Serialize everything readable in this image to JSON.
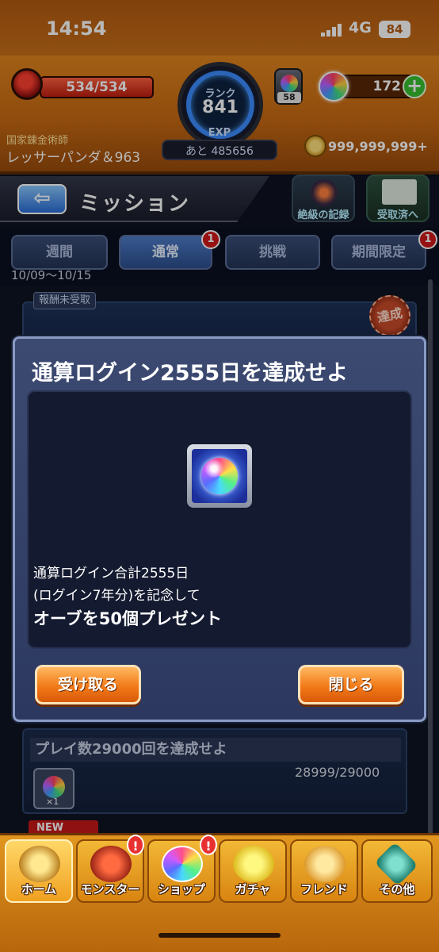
{
  "status_bar": {
    "time": "14:54",
    "network": "4G",
    "battery": "84"
  },
  "hud": {
    "stamina": "534/534",
    "stamina_fraction": 1.0,
    "rank_label": "ランク",
    "rank": "841",
    "exp_label": "EXP",
    "exp_remaining": "あと 485656",
    "orb_stock": "58",
    "orbs": "172",
    "user_title": "国家錬金術師",
    "user_name": "レッサーパンダ＆963",
    "coins": "999,999,999+"
  },
  "header": {
    "title": "ミッション",
    "record_button": "絶級の記録",
    "received_button": "受取済へ"
  },
  "tabs": [
    {
      "label": "週間",
      "badge": ""
    },
    {
      "label": "通常",
      "badge": "1"
    },
    {
      "label": "挑戦",
      "badge": ""
    },
    {
      "label": "期間限定",
      "badge": "1"
    }
  ],
  "date_range": "10/09～10/15",
  "list": {
    "unclaimed_tag": "報酬未受取",
    "done_stamp": "達成",
    "card2_title": "プレイ数29000回を達成せよ",
    "card2_progress": "28999/29000",
    "card2_qty": "×1",
    "new_tag": "NEW"
  },
  "modal": {
    "title": "通算ログイン2555日を達成せよ",
    "desc_line1": "通算ログイン合計2555日",
    "desc_line2": "(ログイン7年分)を記念して",
    "desc_line3": "オーブを50個プレゼント",
    "receive_button": "受け取る",
    "close_button": "閉じる"
  },
  "bottom_nav": [
    {
      "label": "ホーム",
      "alert": ""
    },
    {
      "label": "モンスター",
      "alert": "!"
    },
    {
      "label": "ショップ",
      "alert": "!"
    },
    {
      "label": "ガチャ",
      "alert": ""
    },
    {
      "label": "フレンド",
      "alert": ""
    },
    {
      "label": "その他",
      "alert": ""
    }
  ],
  "colors": {
    "accent_orange": "#f27a18",
    "tab_active": "#4e7cc8",
    "alert_red": "#e83030"
  }
}
